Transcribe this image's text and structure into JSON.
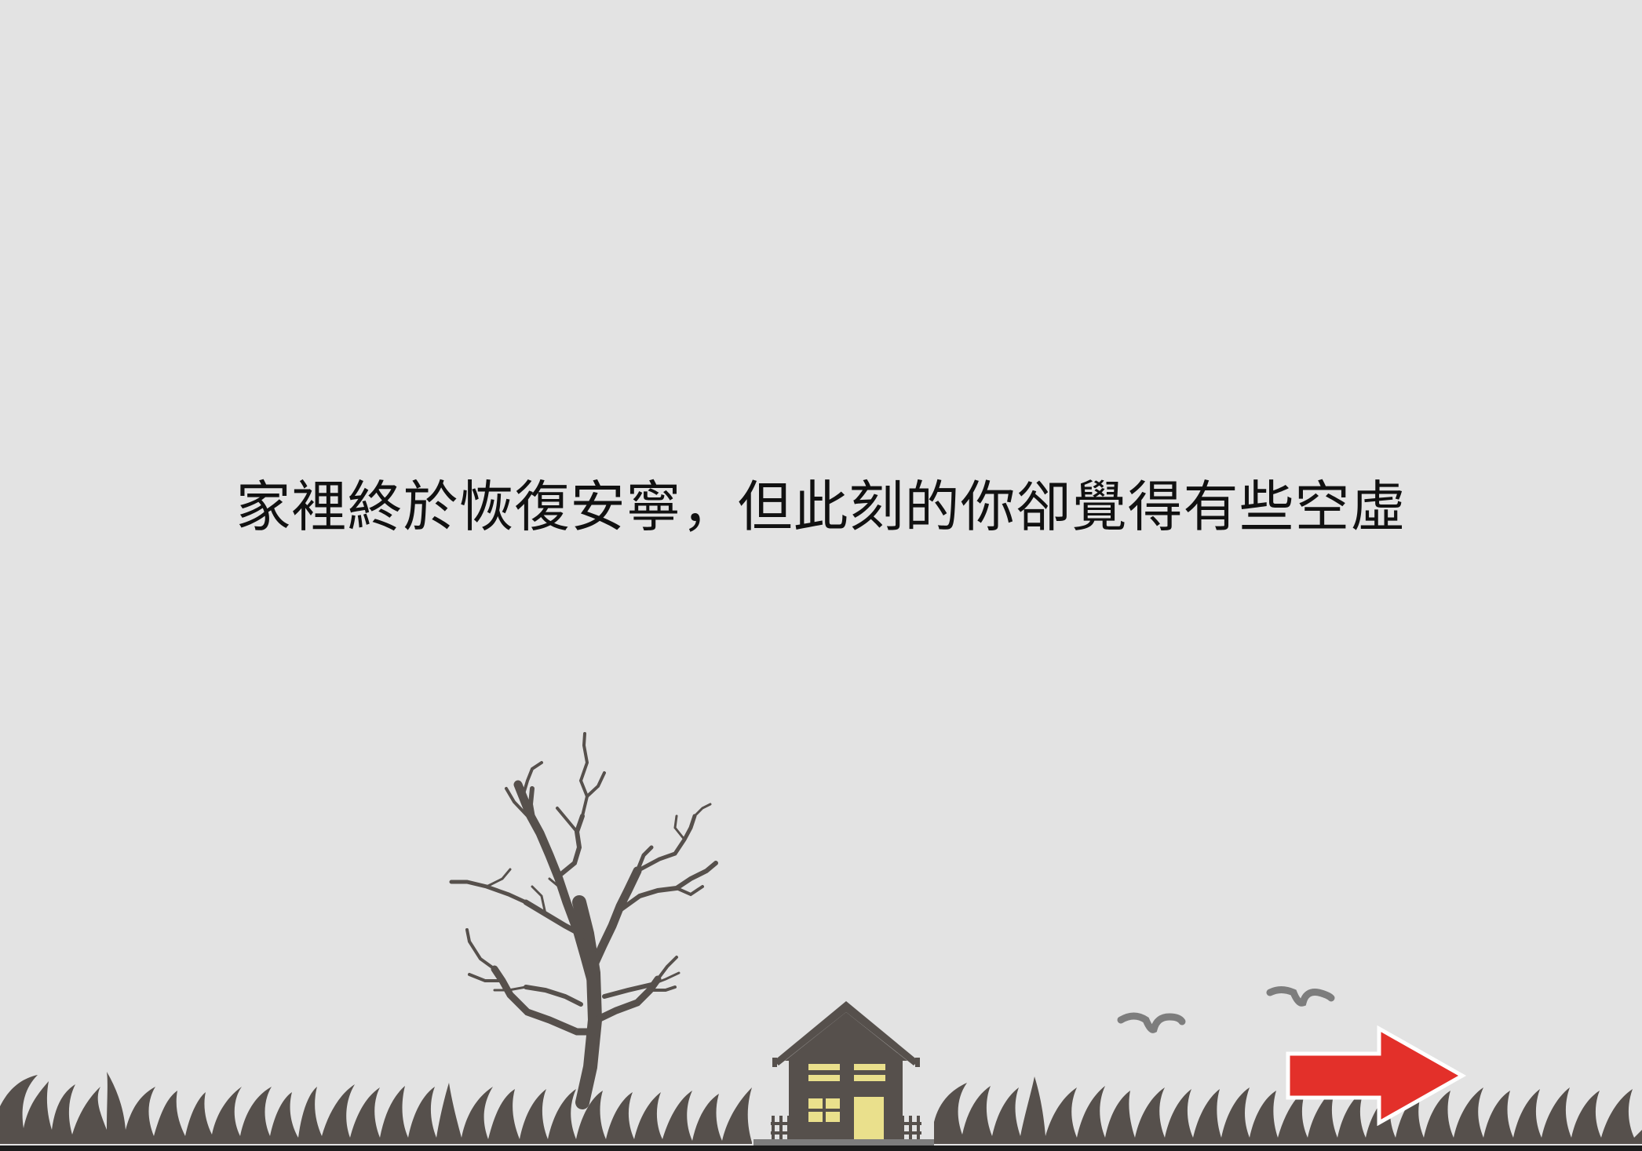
{
  "story": {
    "narration": "家裡終於恢復安寧，但此刻的你卻覺得有些空虛"
  },
  "scene": {
    "background_color": "#e3e3e3",
    "silhouette_color": "#56504c",
    "window_color": "#eae08c",
    "bird_color": "#7d7d7d",
    "ground_color": "#1c1c1c",
    "elements": [
      "bare-tree",
      "house",
      "grass",
      "birds",
      "fence"
    ]
  },
  "controls": {
    "next_button": {
      "icon": "right-arrow-icon",
      "fill_color": "#e3302a",
      "outline_color": "#ffffff"
    }
  }
}
